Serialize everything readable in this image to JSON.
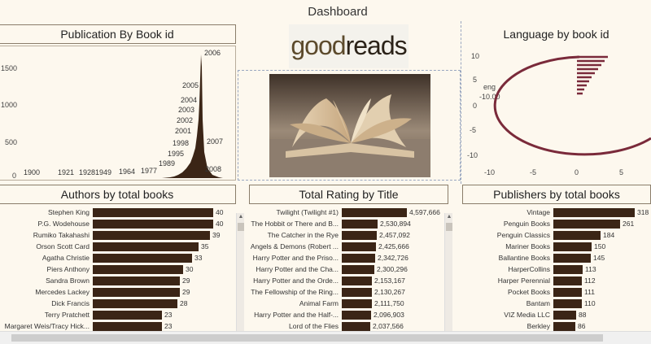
{
  "dashboard": {
    "title": "Dashboard"
  },
  "logo": {
    "text_light": "good",
    "text_bold": "reads"
  },
  "publication_panel": {
    "title": "Publication By Book id",
    "y_ticks": [
      "1500",
      "1000",
      "500",
      "0"
    ],
    "years": [
      "1900",
      "1921",
      "1928",
      "1949",
      "1964",
      "1977",
      "1989",
      "1995",
      "1998",
      "2001",
      "2002",
      "2003",
      "2004",
      "2005",
      "2006",
      "2007",
      "2008"
    ]
  },
  "language_panel": {
    "title": "Language by book id",
    "y_ticks": [
      "10",
      "5",
      "0",
      "-5",
      "-10"
    ],
    "x_ticks": [
      "-10",
      "-5",
      "0",
      "5"
    ],
    "annotation_name": "eng",
    "annotation_value": "-10.00"
  },
  "authors_panel": {
    "title": "Authors by total books",
    "rows": [
      {
        "label": "Stephen King",
        "value": "40"
      },
      {
        "label": "P.G. Wodehouse",
        "value": "40"
      },
      {
        "label": "Rumiko Takahashi",
        "value": "39"
      },
      {
        "label": "Orson Scott Card",
        "value": "35"
      },
      {
        "label": "Agatha Christie",
        "value": "33"
      },
      {
        "label": "Piers Anthony",
        "value": "30"
      },
      {
        "label": "Sandra Brown",
        "value": "29"
      },
      {
        "label": "Mercedes Lackey",
        "value": "29"
      },
      {
        "label": "Dick Francis",
        "value": "28"
      },
      {
        "label": "Terry Pratchett",
        "value": "23"
      },
      {
        "label": "Margaret Weis/Tracy Hick...",
        "value": "23"
      }
    ]
  },
  "rating_panel": {
    "title": "Total Rating by Title",
    "rows": [
      {
        "label": "Twilight (Twilight #1)",
        "value": "4,597,666"
      },
      {
        "label": "The Hobbit  or There and B...",
        "value": "2,530,894"
      },
      {
        "label": "The Catcher in the Rye",
        "value": "2,457,092"
      },
      {
        "label": "Angels & Demons (Robert ...",
        "value": "2,425,666"
      },
      {
        "label": "Harry Potter and the Priso...",
        "value": "2,342,726"
      },
      {
        "label": "Harry Potter and the Cha...",
        "value": "2,300,296"
      },
      {
        "label": "Harry Potter and the Orde...",
        "value": "2,153,167"
      },
      {
        "label": "The Fellowship of the Ring...",
        "value": "2,130,267"
      },
      {
        "label": "Animal Farm",
        "value": "2,111,750"
      },
      {
        "label": "Harry Potter and the Half-...",
        "value": "2,096,903"
      },
      {
        "label": "Lord of the Flies",
        "value": "2,037,566"
      }
    ]
  },
  "publishers_panel": {
    "title": "Publishers by total books",
    "rows": [
      {
        "label": "Vintage",
        "value": "318"
      },
      {
        "label": "Penguin Books",
        "value": "261"
      },
      {
        "label": "Penguin Classics",
        "value": "184"
      },
      {
        "label": "Mariner Books",
        "value": "150"
      },
      {
        "label": "Ballantine Books",
        "value": "145"
      },
      {
        "label": "HarperCollins",
        "value": "113"
      },
      {
        "label": "Harper Perennial",
        "value": "112"
      },
      {
        "label": "Pocket Books",
        "value": "111"
      },
      {
        "label": "Bantam",
        "value": "110"
      },
      {
        "label": "VIZ Media LLC",
        "value": "88"
      },
      {
        "label": "Berkley",
        "value": "86"
      }
    ]
  },
  "colors": {
    "bar": "#3b2516",
    "language_line": "#7a2a3a",
    "background": "#fdf8ee"
  }
}
